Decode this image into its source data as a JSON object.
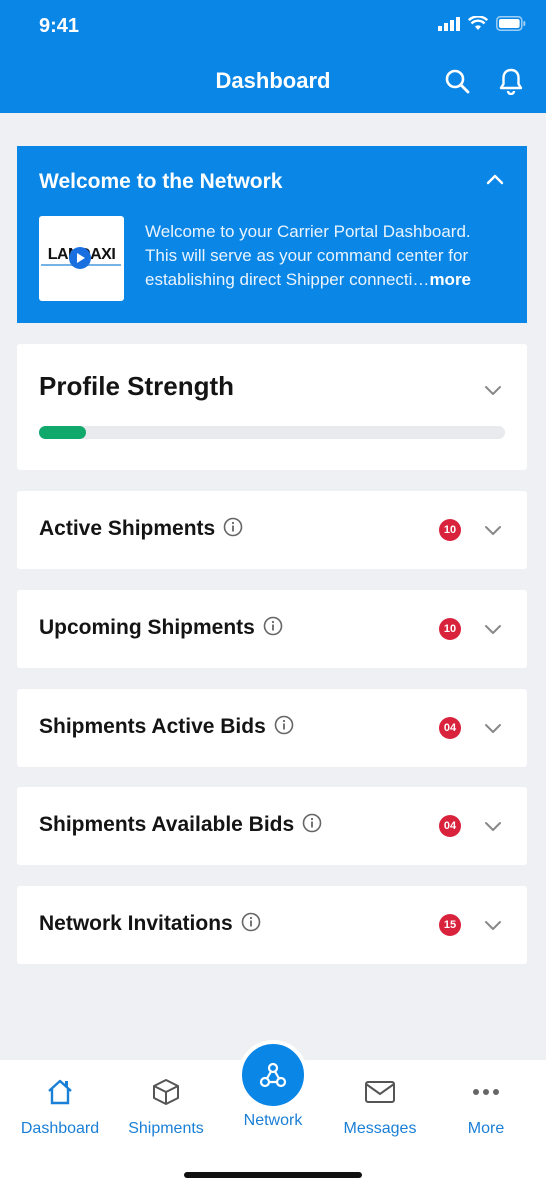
{
  "status_bar": {
    "time": "9:41"
  },
  "header": {
    "title": "Dashboard",
    "search_icon": "search-icon",
    "bell_icon": "bell-icon"
  },
  "welcome": {
    "title": "Welcome to the Network",
    "logo_text": "LANDAXI",
    "body": "Welcome to your Carrier Portal Dashboard. This will serve as your command center for establishing direct Shipper connecti…",
    "more": "more"
  },
  "profile": {
    "title": "Profile Strength",
    "progress": 0.1
  },
  "sections": [
    {
      "title": "Active Shipments",
      "count": "10"
    },
    {
      "title": "Upcoming Shipments",
      "count": "10"
    },
    {
      "title": "Shipments Active Bids",
      "count": "04"
    },
    {
      "title": "Shipments Available Bids",
      "count": "04"
    },
    {
      "title": "Network Invitations",
      "count": "15"
    }
  ],
  "tabbar": {
    "dashboard": "Dashboard",
    "shipments": "Shipments",
    "network": "Network",
    "messages": "Messages",
    "more": "More"
  },
  "colors": {
    "primary": "#0a86e6",
    "badge": "#d9233d",
    "progress": "#10a86b"
  }
}
